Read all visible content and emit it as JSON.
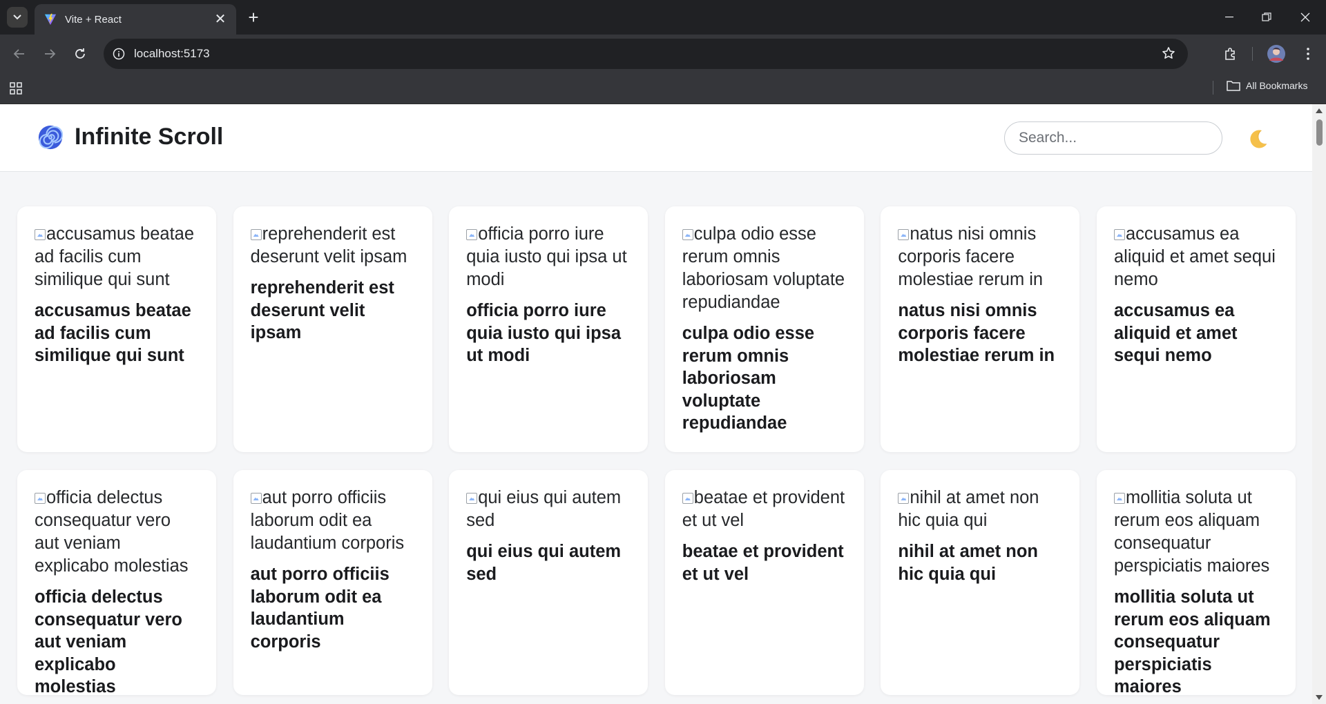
{
  "browser": {
    "tab_title": "Vite + React",
    "url": "localhost:5173",
    "all_bookmarks": "All Bookmarks"
  },
  "app": {
    "title": "Infinite Scroll",
    "logo_icon": "spiral-icon",
    "search_placeholder": "Search...",
    "theme_icon": "crescent-moon-icon"
  },
  "posts": [
    {
      "alt": "accusamus beatae ad facilis cum similique qui sunt",
      "title": "accusamus beatae ad facilis cum similique qui sunt"
    },
    {
      "alt": "reprehenderit est deserunt velit ipsam",
      "title": "reprehenderit est deserunt velit ipsam"
    },
    {
      "alt": "officia porro iure quia iusto qui ipsa ut modi",
      "title": "officia porro iure quia iusto qui ipsa ut modi"
    },
    {
      "alt": "culpa odio esse rerum omnis laboriosam voluptate repudiandae",
      "title": "culpa odio esse rerum omnis laboriosam voluptate repudiandae"
    },
    {
      "alt": "natus nisi omnis corporis facere molestiae rerum in",
      "title": "natus nisi omnis corporis facere molestiae rerum in"
    },
    {
      "alt": "accusamus ea aliquid et amet sequi nemo",
      "title": "accusamus ea aliquid et amet sequi nemo"
    },
    {
      "alt": "officia delectus consequatur vero aut veniam explicabo molestias",
      "title": "officia delectus consequatur vero aut veniam explicabo molestias"
    },
    {
      "alt": "aut porro officiis laborum odit ea laudantium corporis",
      "title": "aut porro officiis laborum odit ea laudantium corporis"
    },
    {
      "alt": "qui eius qui autem sed",
      "title": "qui eius qui autem sed"
    },
    {
      "alt": "beatae et provident et ut vel",
      "title": "beatae et provident et ut vel"
    },
    {
      "alt": "nihil at amet non hic quia qui",
      "title": "nihil at amet non hic quia qui"
    },
    {
      "alt": "mollitia soluta ut rerum eos aliquam consequatur perspiciatis maiores",
      "title": "mollitia soluta ut rerum eos aliquam consequatur perspiciatis maiores"
    }
  ]
}
